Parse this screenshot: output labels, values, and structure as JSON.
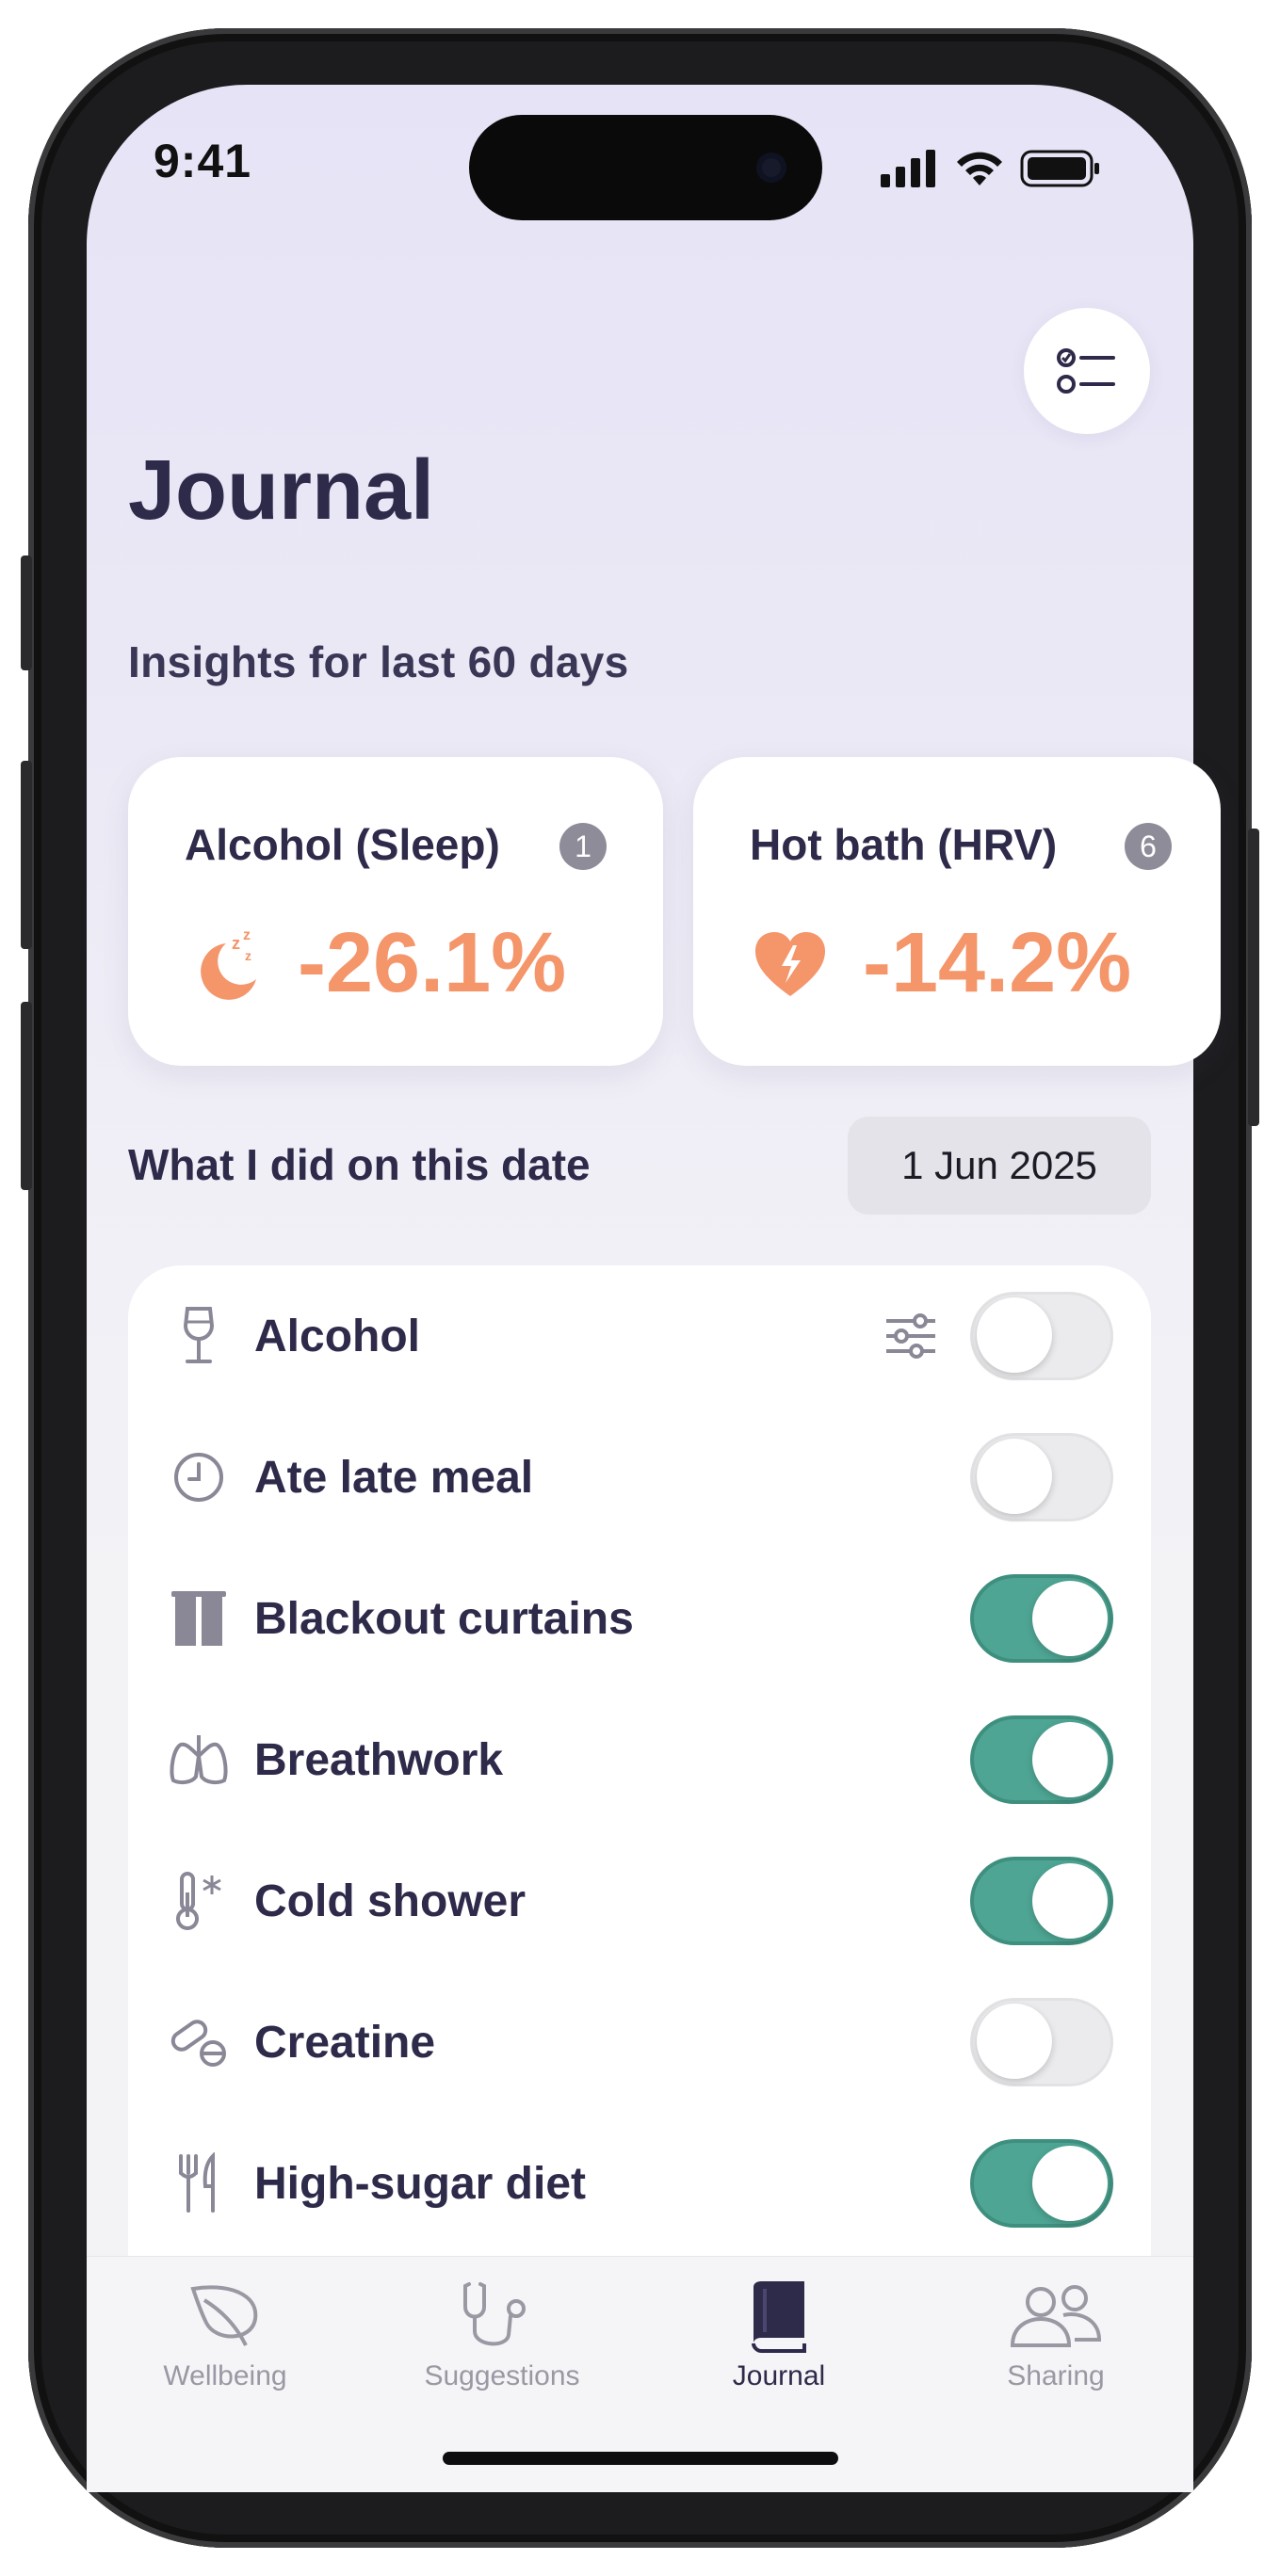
{
  "status_bar": {
    "time": "9:41"
  },
  "header": {
    "title": "Journal",
    "filter_icon": "checklist-icon"
  },
  "insights": {
    "heading": "Insights for last 60 days",
    "cards": [
      {
        "title": "Alcohol (Sleep)",
        "count": "1",
        "icon": "sleep-moon-icon",
        "value": "-26.1%",
        "color": "#f4956a"
      },
      {
        "title": "Hot bath (HRV)",
        "count": "6",
        "icon": "heart-bolt-icon",
        "value": "-14.2%",
        "color": "#f4956a"
      }
    ]
  },
  "activities": {
    "heading": "What I did on this date",
    "date": "1 Jun 2025",
    "items": [
      {
        "label": "Alcohol",
        "icon": "wine-glass-icon",
        "enabled": false,
        "has_settings": true
      },
      {
        "label": "Ate late meal",
        "icon": "clock-icon",
        "enabled": false
      },
      {
        "label": "Blackout curtains",
        "icon": "curtains-icon",
        "enabled": true
      },
      {
        "label": "Breathwork",
        "icon": "lungs-icon",
        "enabled": true
      },
      {
        "label": "Cold shower",
        "icon": "thermometer-snow-icon",
        "enabled": true
      },
      {
        "label": "Creatine",
        "icon": "pills-icon",
        "enabled": false
      },
      {
        "label": "High-sugar diet",
        "icon": "fork-knife-icon",
        "enabled": true
      }
    ]
  },
  "tabbar": {
    "tabs": [
      {
        "label": "Wellbeing",
        "icon": "leaf-icon",
        "active": false
      },
      {
        "label": "Suggestions",
        "icon": "stethoscope-icon",
        "active": false
      },
      {
        "label": "Journal",
        "icon": "book-icon",
        "active": true
      },
      {
        "label": "Sharing",
        "icon": "people-icon",
        "active": false
      }
    ]
  },
  "colors": {
    "accent": "#4ea593",
    "insight": "#f4956a",
    "title": "#2d2a4a"
  }
}
